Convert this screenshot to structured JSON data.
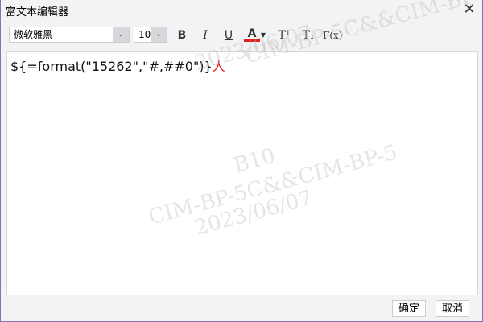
{
  "window": {
    "title": "富文本编辑器",
    "close_icon": "close-icon"
  },
  "toolbar": {
    "font": "微软雅黑",
    "size": "10",
    "bold": "B",
    "italic": "I",
    "underline": "U",
    "font_color": "A",
    "font_color_value": "#e02020",
    "superscript": "T¹",
    "subscript": "T₁",
    "formula": "F(x)"
  },
  "editor": {
    "content": "${=format(\"15262\",\"#,##0\")}",
    "cursor_char": "人"
  },
  "buttons": {
    "ok": "确定",
    "cancel": "取消"
  },
  "watermark": {
    "line1": "B10",
    "line2": "CIM-BP-5C&&CIM-BP-5",
    "line3": "2023/06/07"
  }
}
